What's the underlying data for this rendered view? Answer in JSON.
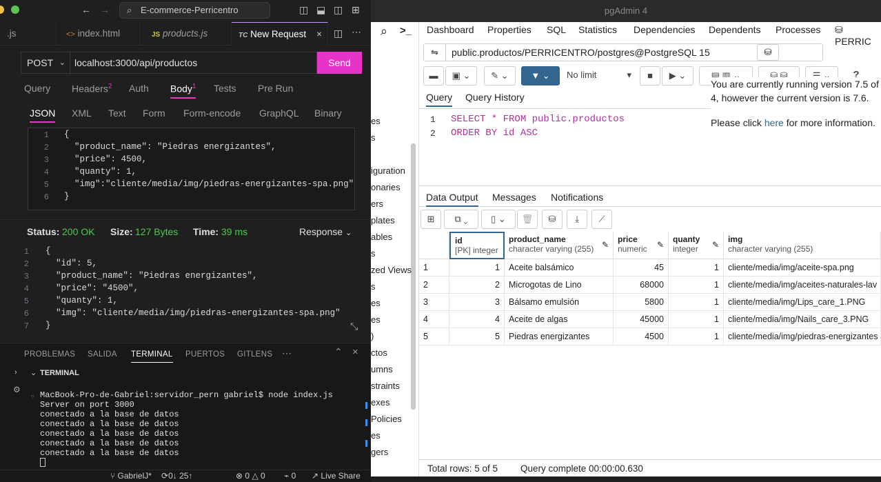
{
  "vscode": {
    "search_box": "E-commerce-Perricentro",
    "tabs": [
      ".js",
      "index.html",
      "products.js",
      "New Request"
    ],
    "tab_prefix_js": "JS",
    "tab_prefix_tc": "TC",
    "tab_prefix_html": "<>",
    "request": {
      "method": "POST",
      "url": "localhost:3000/api/productos",
      "send": "Send",
      "tabs": [
        "Query",
        "Headers",
        "Auth",
        "Body",
        "Tests",
        "Pre Run"
      ],
      "headers_count": "2",
      "body_count": "1",
      "body_tabs": [
        "JSON",
        "XML",
        "Text",
        "Form",
        "Form-encode",
        "GraphQL",
        "Binary"
      ],
      "body_lines": [
        "{",
        "  \"product_name\": \"Piedras energizantes\",",
        "  \"price\": 4500,",
        "  \"quanty\": 1,",
        "  \"img\":\"cliente/media/img/piedras-energizantes-spa.png\"",
        "}"
      ]
    },
    "response": {
      "status_label": "Status:",
      "status_value": "200 OK",
      "size_label": "Size:",
      "size_value": "127 Bytes",
      "time_label": "Time:",
      "time_value": "39 ms",
      "response_tab": "Response",
      "lines": [
        "{",
        "  \"id\": 5,",
        "  \"product_name\": \"Piedras energizantes\",",
        "  \"price\": \"4500\",",
        "  \"quanty\": 1,",
        "  \"img\": \"cliente/media/img/piedras-energizantes-spa.png\"",
        "}"
      ]
    },
    "panel": {
      "tabs": [
        "PROBLEMAS",
        "SALIDA",
        "TERMINAL",
        "PUERTOS",
        "GITLENS"
      ],
      "section": "TERMINAL",
      "terminal_lines": [
        "MacBook-Pro-de-Gabriel:servidor_pern gabriel$ node index.js",
        "Server on port 3000",
        "conectado a la base de datos",
        "conectado a la base de datos",
        "conectado a la base de datos",
        "conectado a la base de datos",
        "conectado a la base de datos"
      ]
    },
    "statusbar": {
      "branch": "GabrielJ*",
      "sync": "0↓ 25↑",
      "errors": "0",
      "warnings": "0",
      "info": "0",
      "live_share": "Live Share"
    }
  },
  "pgadmin": {
    "title": "pgAdmin 4",
    "nav": [
      "Dashboard",
      "Properties",
      "SQL",
      "Statistics",
      "Dependencies",
      "Dependents",
      "Processes",
      "PERRIC"
    ],
    "connection": "public.productos/PERRICENTRO/postgres@PostgreSQL 15",
    "limit": "No limit",
    "query_tabs": [
      "Query",
      "Query History"
    ],
    "sql_lines": [
      "SELECT * FROM public.productos",
      "ORDER BY id ASC"
    ],
    "notice_lines": [
      "You are currently running version 7.5 of",
      "4, however the current version is 7.6.",
      "Please click",
      "here",
      "for more information."
    ],
    "tree_items": [
      "es",
      "s",
      "iguration",
      "onaries",
      "ers",
      "plates",
      "ables",
      "s",
      "zed Views",
      "s",
      "es",
      "es",
      ")",
      "ctos",
      "umns",
      "straints",
      "exes",
      "Policies",
      "es",
      "gers"
    ],
    "output_tabs": [
      "Data Output",
      "Messages",
      "Notifications"
    ],
    "columns": [
      {
        "name": "id",
        "type": "[PK] integer"
      },
      {
        "name": "product_name",
        "type": "character varying (255)"
      },
      {
        "name": "price",
        "type": "numeric"
      },
      {
        "name": "quanty",
        "type": "integer"
      },
      {
        "name": "img",
        "type": "character varying (255)"
      }
    ],
    "rows": [
      [
        "1",
        "1",
        "Aceite balsámico",
        "45",
        "1",
        "cliente/media/img/aceite-spa.png"
      ],
      [
        "2",
        "2",
        "Microgotas de Lino",
        "68000",
        "1",
        "cliente/media/img/aceites-naturales-lav"
      ],
      [
        "3",
        "3",
        "Bálsamo emulsión",
        "5800",
        "1",
        "cliente/media/img/Lips_care_1.PNG"
      ],
      [
        "4",
        "4",
        "Aceite de algas",
        "45000",
        "1",
        "cliente/media/img/Nails_care_3.PNG"
      ],
      [
        "5",
        "5",
        "Piedras energizantes",
        "4500",
        "1",
        "cliente/media/img/piedras-energizantes"
      ]
    ],
    "status_rows": "Total rows: 5 of 5",
    "status_query": "Query complete 00:00:00.630"
  }
}
